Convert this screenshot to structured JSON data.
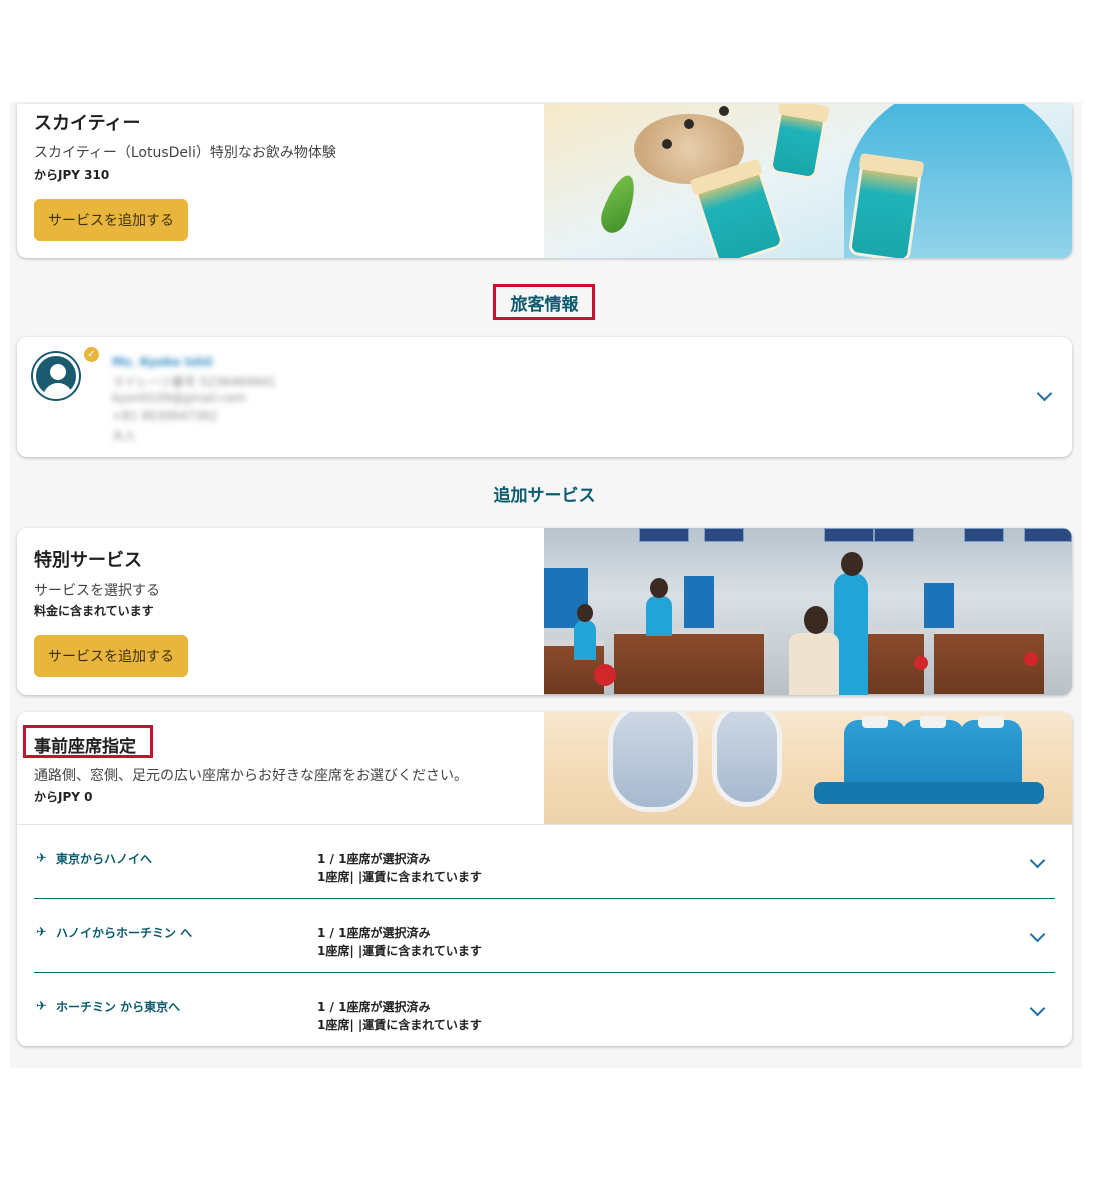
{
  "sky_tea": {
    "title": "スカイティー",
    "description": "スカイティー（LotusDeli）特別なお飲み物体験",
    "price": "からJPY 310",
    "button_label": "サービスを追加する"
  },
  "passenger_section": {
    "title": "旅客情報",
    "passenger": {
      "name": "Ms. Kyoko Ishii",
      "membership": "マイレージ番号 5236469941",
      "email": "kyon0109@gmail.com",
      "phone": "+81 9030647362",
      "type": "大人"
    }
  },
  "additional_services": {
    "title": "追加サービス"
  },
  "special_service": {
    "title": "特別サービス",
    "description": "サービスを選択する",
    "price": "料金に含まれています",
    "button_label": "サービスを追加する"
  },
  "seat_selection": {
    "title": "事前座席指定",
    "description": "通路側、窓側、足元の広い座席からお好きな座席をお選びください。",
    "price": "からJPY 0",
    "flights": [
      {
        "route": "東京からハノイへ",
        "status": "1 / 1座席が選択済み",
        "detail": "1座席| |運賃に含まれています"
      },
      {
        "route": "ハノイからホーチミン へ",
        "status": "1 / 1座席が選択済み",
        "detail": "1座席| |運賃に含まれています"
      },
      {
        "route": "ホーチミン から東京へ",
        "status": "1 / 1座席が選択済み",
        "detail": "1座席| |運賃に含まれています"
      }
    ]
  },
  "icons": {
    "plane": "plane-icon",
    "chevron": "chevron-down-icon",
    "verified": "check-badge-icon"
  },
  "colors": {
    "accent_button": "#e8b63c",
    "heading_teal": "#0b5b6f",
    "highlight_red": "#c8102e"
  }
}
